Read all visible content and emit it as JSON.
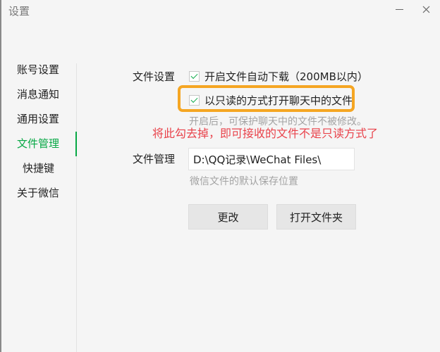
{
  "window": {
    "title": "设置"
  },
  "sidebar": {
    "items": [
      {
        "label": "账号设置"
      },
      {
        "label": "消息通知"
      },
      {
        "label": "通用设置"
      },
      {
        "label": "文件管理"
      },
      {
        "label": "快捷键"
      },
      {
        "label": "关于微信"
      }
    ],
    "active_index": 3
  },
  "file_settings": {
    "label": "文件设置",
    "auto_download": {
      "label": "开启文件自动下载（200MB以内）",
      "checked": true
    },
    "read_only": {
      "label": "以只读的方式打开聊天中的文件",
      "checked": true
    },
    "read_only_hint": "开启后，可保护聊天中的文件不被修改。"
  },
  "annotation": {
    "text": "将此勾去掉，即可接收的文件不是只读方式了",
    "color": "#e9434b",
    "highlight_color": "#f5a623"
  },
  "file_management": {
    "label": "文件管理",
    "path_value": "D:\\QQ记录\\WeChat Files\\",
    "hint": "微信文件的默认保存位置"
  },
  "buttons": {
    "change_label": "更改",
    "open_folder_label": "打开文件夹"
  },
  "colors": {
    "accent": "#07a845"
  }
}
